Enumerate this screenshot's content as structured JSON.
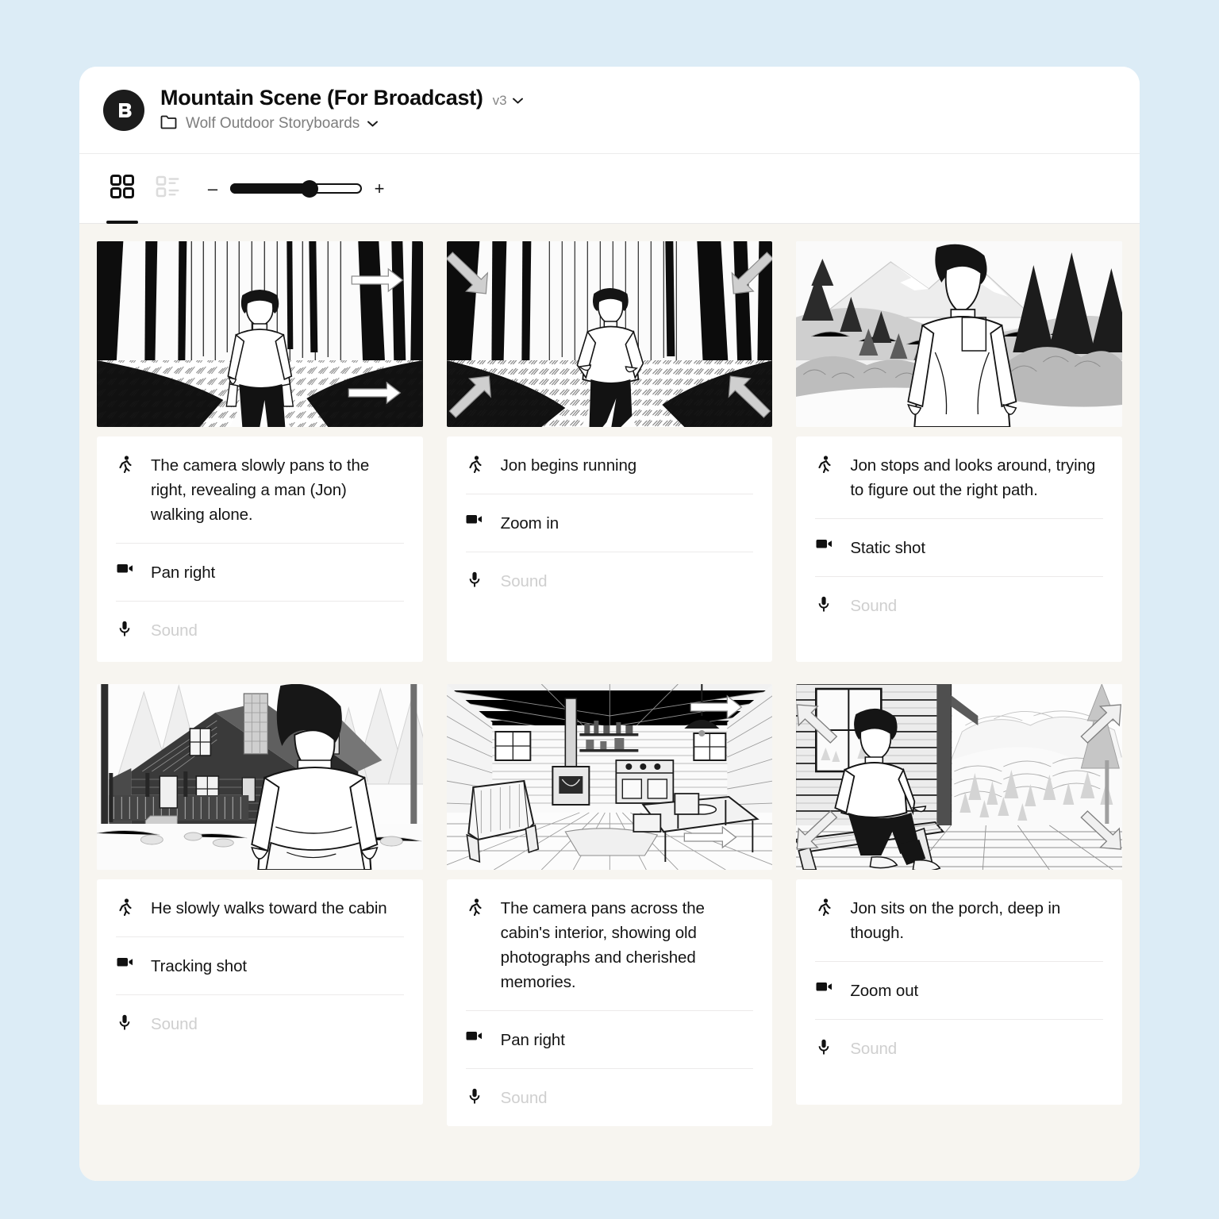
{
  "header": {
    "logo_icon": "boords-b-logo",
    "title": "Mountain Scene (For Broadcast)",
    "version": "v3",
    "version_chevron_icon": "chevron-down-icon",
    "folder_icon": "folder-icon",
    "folder_name": "Wolf Outdoor Storyboards",
    "folder_chevron_icon": "chevron-down-icon"
  },
  "toolbar": {
    "grid_view_icon": "grid-view-icon",
    "list_view_icon": "list-view-icon",
    "active_view": "grid",
    "zoom_out_label": "–",
    "zoom_in_label": "+",
    "zoom_percent": 60
  },
  "icons": {
    "action": "running-person-icon",
    "camera": "video-camera-icon",
    "sound": "microphone-icon"
  },
  "frames": [
    {
      "thumbnail": "man-walking-in-forest",
      "overlay": "pan-right-arrows",
      "action": "The camera slowly pans to the right, revealing a man (Jon) walking alone.",
      "camera": "Pan right",
      "sound": "",
      "sound_placeholder": "Sound"
    },
    {
      "thumbnail": "man-running-in-forest",
      "overlay": "zoom-in-arrows",
      "action": "Jon begins running",
      "camera": "Zoom in",
      "sound": "",
      "sound_placeholder": "Sound"
    },
    {
      "thumbnail": "man-standing-mountain-view",
      "overlay": "none",
      "action": "Jon stops and looks around, trying to figure out the right path.",
      "camera": "Static shot",
      "sound": "",
      "sound_placeholder": "Sound"
    },
    {
      "thumbnail": "man-facing-cabin",
      "overlay": "none",
      "action": "He slowly walks toward the cabin",
      "camera": "Tracking shot",
      "sound": "",
      "sound_placeholder": "Sound"
    },
    {
      "thumbnail": "cabin-interior",
      "overlay": "pan-right-arrows",
      "action": "The camera pans across the cabin's interior, showing old photographs and cherished memories.",
      "camera": "Pan right",
      "sound": "",
      "sound_placeholder": "Sound"
    },
    {
      "thumbnail": "man-sitting-on-porch",
      "overlay": "zoom-out-arrows",
      "action": "Jon sits on the porch, deep in though.",
      "camera": "Zoom out",
      "sound": "",
      "sound_placeholder": "Sound"
    }
  ],
  "colors": {
    "page_background": "#dcecf6",
    "window_background": "#ffffff",
    "canvas_background": "#f7f5f0",
    "card_background": "#ffffff",
    "text_primary": "#141414",
    "text_muted": "#7d7d7d",
    "placeholder": "#cfcfcf",
    "accent": "#111111"
  }
}
